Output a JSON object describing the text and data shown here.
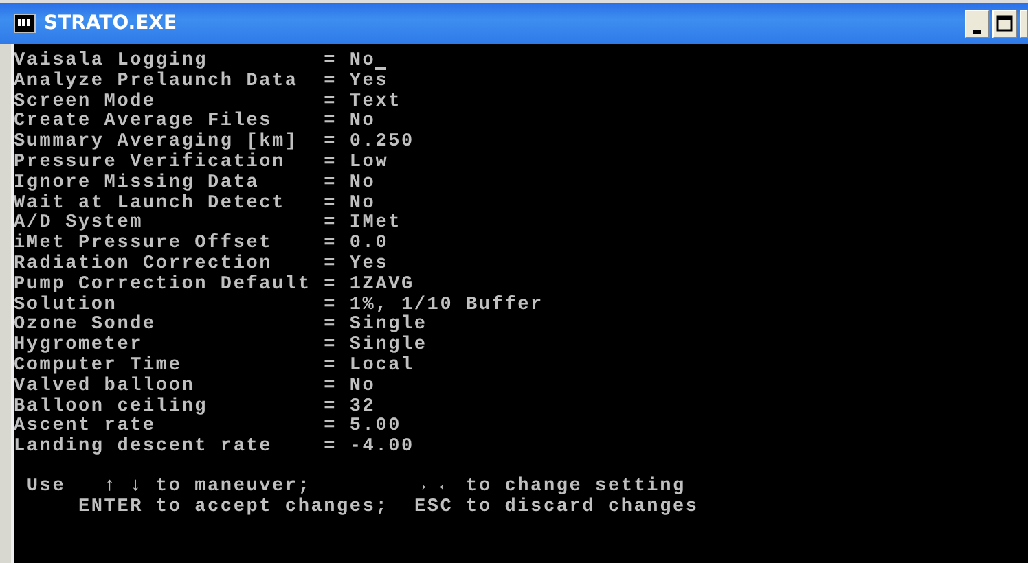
{
  "window": {
    "title": "STRATO.EXE"
  },
  "settings": [
    {
      "label": "Vaisala Logging",
      "value": "= No",
      "selected": true
    },
    {
      "label": "Analyze Prelaunch Data",
      "value": "= Yes",
      "selected": false
    },
    {
      "label": "Screen Mode",
      "value": "= Text",
      "selected": false
    },
    {
      "label": "Create Average Files",
      "value": "= No",
      "selected": false
    },
    {
      "label": "Summary Averaging [km]",
      "value": "= 0.250",
      "selected": false
    },
    {
      "label": "Pressure Verification",
      "value": "= Low",
      "selected": false
    },
    {
      "label": "Ignore Missing Data",
      "value": "= No",
      "selected": false
    },
    {
      "label": "Wait at Launch Detect",
      "value": "= No",
      "selected": false
    },
    {
      "label": "A/D System",
      "value": "= IMet",
      "selected": false
    },
    {
      "label": "iMet Pressure Offset",
      "value": "= 0.0",
      "selected": false
    },
    {
      "label": "Radiation Correction",
      "value": "= Yes",
      "selected": false
    },
    {
      "label": "Pump Correction Default",
      "value": "= 1ZAVG",
      "selected": false
    },
    {
      "label": "Solution",
      "value": "= 1%, 1/10 Buffer",
      "selected": false
    },
    {
      "label": "Ozone Sonde",
      "value": "= Single",
      "selected": false
    },
    {
      "label": "Hygrometer",
      "value": "= Single",
      "selected": false
    },
    {
      "label": "Computer Time",
      "value": "= Local",
      "selected": false
    },
    {
      "label": "Valved balloon",
      "value": "= No",
      "selected": false
    },
    {
      "label": "Balloon ceiling",
      "value": "= 32",
      "selected": false
    },
    {
      "label": "Ascent rate",
      "value": "= 5.00",
      "selected": false
    },
    {
      "label": "Landing descent rate",
      "value": "= -4.00",
      "selected": false
    }
  ],
  "help": [
    " Use   ↑ ↓ to maneuver;        → ← to change setting",
    "     ENTER to accept changes;  ESC to discard changes"
  ]
}
